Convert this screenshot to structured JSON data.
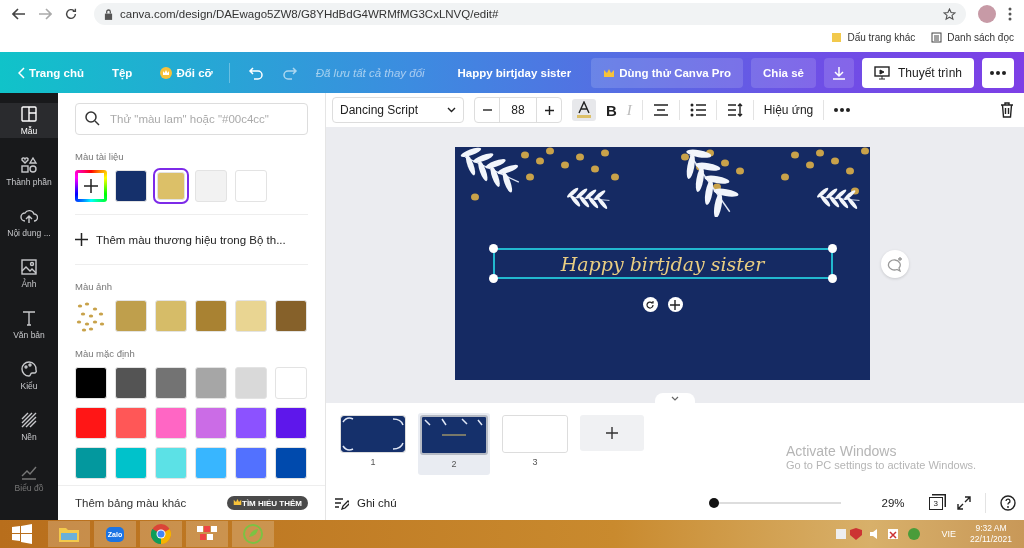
{
  "browser": {
    "url": "canva.com/design/DAEwago5ZW8/G8YHdBdG4WRMfMG3CxLNVQ/edit#",
    "bookmarks": [
      "Dấu trang khác",
      "Danh sách đọc"
    ]
  },
  "topbar": {
    "home": "Trang chủ",
    "file": "Tệp",
    "resize": "Đổi cỡ",
    "saved": "Đã lưu tất cả thay đổi",
    "title": "Happy birtjday sister",
    "pro": "Dùng thử Canva Pro",
    "share": "Chia sẻ",
    "present": "Thuyết trình"
  },
  "rail": [
    {
      "kind": "templates",
      "label": "Mẫu",
      "selected": true
    },
    {
      "kind": "elements",
      "label": "Thành phần",
      "selected": false
    },
    {
      "kind": "uploads",
      "label": "Nội dung ...",
      "selected": false
    },
    {
      "kind": "photos",
      "label": "Ảnh",
      "selected": false
    },
    {
      "kind": "text",
      "label": "Văn bản",
      "selected": false
    },
    {
      "kind": "styles",
      "label": "Kiểu",
      "selected": false
    },
    {
      "kind": "background",
      "label": "Nền",
      "selected": false
    },
    {
      "kind": "charts",
      "label": "Biểu đồ",
      "selected": false
    }
  ],
  "panel": {
    "search_placeholder": "Thử \"màu lam\" hoặc \"#00c4cc\"",
    "document_colors": {
      "title": "Màu tài liệu",
      "swatches": [
        {
          "kind": "add",
          "selected": false
        },
        {
          "kind": "color",
          "color": "#15306b",
          "selected": false
        },
        {
          "kind": "color",
          "color": "#dcc068",
          "selected": true
        },
        {
          "kind": "color",
          "color": "#f2f2f2",
          "selected": false
        },
        {
          "kind": "color",
          "color": "#ffffff",
          "selected": false
        }
      ]
    },
    "add_brand": "Thêm màu thương hiệu trong Bộ th...",
    "photo_colors": {
      "title": "Màu ảnh",
      "swatches": [
        {
          "kind": "photo"
        },
        {
          "kind": "color",
          "color": "#bf9f4c"
        },
        {
          "kind": "color",
          "color": "#d6bc68"
        },
        {
          "kind": "color",
          "color": "#a98232"
        },
        {
          "kind": "color",
          "color": "#e9d592"
        },
        {
          "kind": "color",
          "color": "#86612a"
        }
      ]
    },
    "default_colors": {
      "title": "Màu mặc định",
      "swatches": [
        {
          "color": "#000000"
        },
        {
          "color": "#545454"
        },
        {
          "color": "#737373"
        },
        {
          "color": "#a6a6a6"
        },
        {
          "color": "#d9d9d9"
        },
        {
          "color": "#ffffff"
        },
        {
          "color": "#ff1616"
        },
        {
          "color": "#ff5757"
        },
        {
          "color": "#ff66c4"
        },
        {
          "color": "#cb6ce6"
        },
        {
          "color": "#8c52ff"
        },
        {
          "color": "#5e17eb"
        },
        {
          "color": "#03989e"
        },
        {
          "color": "#00c2cb"
        },
        {
          "color": "#5ce1e6"
        },
        {
          "color": "#38b6ff"
        },
        {
          "color": "#5271ff"
        },
        {
          "color": "#004aad"
        }
      ]
    },
    "more_palettes": "Thêm bảng màu khác",
    "learn_more": "TÌM HIỂU THÊM"
  },
  "toolbar": {
    "font": "Dancing Script",
    "size": "88",
    "bold": "B",
    "italic": "I",
    "italic_disabled": true,
    "effects": "Hiệu ứng"
  },
  "design": {
    "text": "Happy birtjday sister"
  },
  "pages": [
    {
      "number": "1",
      "selected": false,
      "kind": "border"
    },
    {
      "number": "2",
      "selected": true,
      "kind": "leaves"
    },
    {
      "number": "3",
      "selected": false,
      "kind": "blank"
    }
  ],
  "bottombar": {
    "notes": "Ghi chú",
    "zoom": {
      "level": 0.03
    },
    "zoom_reading": "29%",
    "page_count": "3"
  },
  "watermark": {
    "title": "Activate Windows",
    "subtitle": "Go to PC settings to activate Windows."
  },
  "taskbar": {
    "apps": [
      {
        "kind": "explorer"
      },
      {
        "kind": "zalo",
        "label": "Zalo"
      },
      {
        "kind": "chrome"
      },
      {
        "kind": "grid"
      },
      {
        "kind": "coccoc"
      }
    ],
    "language": "VIE",
    "time": "9:32 AM",
    "date": "22/11/2021"
  }
}
